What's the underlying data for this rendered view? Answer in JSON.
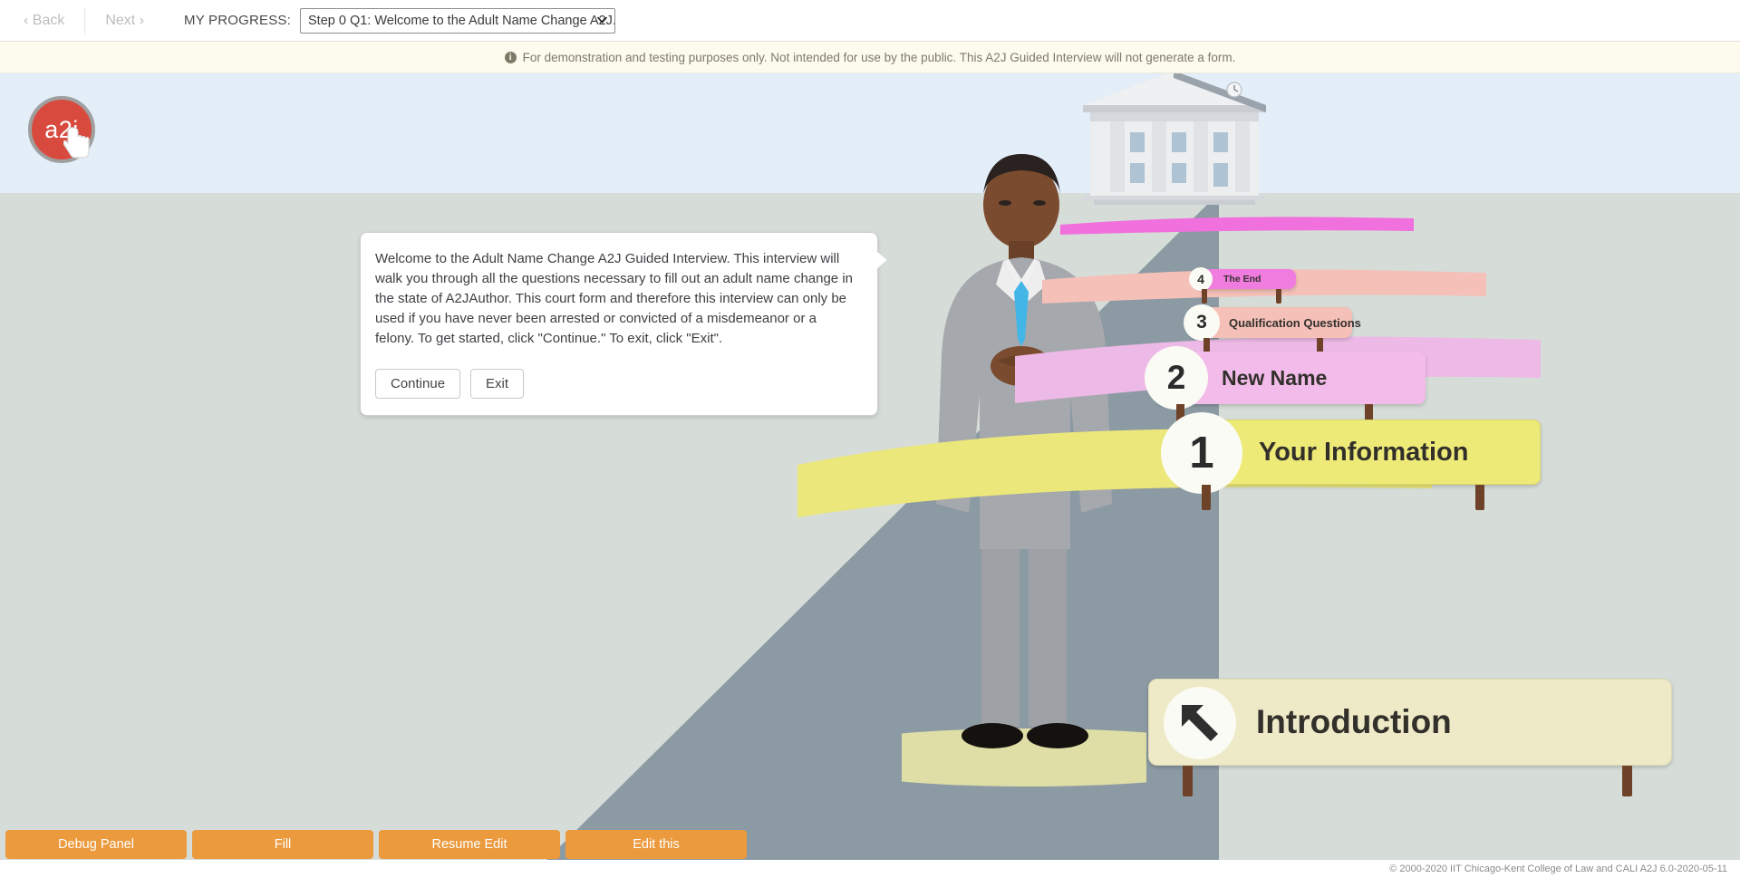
{
  "topnav": {
    "back_label": "‹ Back",
    "next_label": "Next ›",
    "progress_label": "MY PROGRESS:",
    "progress_selected": "Step 0 Q1: Welcome to the Adult Name Change A2J...",
    "caret": "▼"
  },
  "notice": {
    "icon": "info-icon",
    "icon_glyph": "i",
    "text": "For demonstration and testing purposes only. Not intended for use by the public. This A2J Guided Interview will not generate a form."
  },
  "logo": {
    "text": "a2j"
  },
  "dialog": {
    "body": "Welcome to the Adult Name Change A2J Guided Interview. This interview will walk you through all the questions necessary to fill out an adult name change in the state of A2JAuthor. This court form and therefore this interview can only be used if you have never been arrested or convicted of a misdemeanor or a felony. To get started, click \"Continue.\" To exit, click \"Exit\".",
    "continue_label": "Continue",
    "exit_label": "Exit"
  },
  "signs": [
    {
      "number": "4",
      "label": "The End",
      "color": "#f07ce0",
      "ribbon": "#f070dd"
    },
    {
      "number": "3",
      "label": "Qualification Questions",
      "color": "#f4c0b8",
      "ribbon": "#f4c0b8"
    },
    {
      "number": "2",
      "label": "New Name",
      "color": "#f2bbea",
      "ribbon": "#edb9e6"
    },
    {
      "number": "1",
      "label": "Your Information",
      "color": "#eeea77",
      "ribbon": "#ebe77a"
    }
  ],
  "current_sign": {
    "label": "Introduction",
    "icon": "arrow-up-left-icon",
    "color": "#eeeac7"
  },
  "toolbar": {
    "buttons": [
      {
        "label": "Debug Panel"
      },
      {
        "label": "Fill"
      },
      {
        "label": "Resume Edit"
      },
      {
        "label": "Edit this"
      }
    ]
  },
  "footer": {
    "copyright": "© 2000-2020 IIT Chicago-Kent College of Law and CALI A2J 6.0-2020-05-11"
  },
  "colors": {
    "accent_orange": "#eb9a3e",
    "logo_red": "#d94a3e",
    "sky": "#e3eef8",
    "ground": "#d6dcd7",
    "road": "#8c9aa3"
  }
}
